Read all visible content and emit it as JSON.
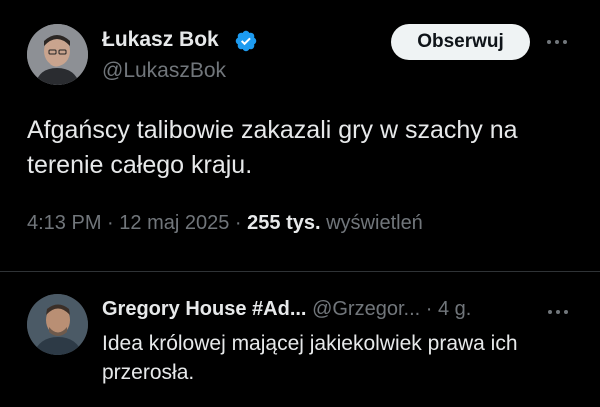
{
  "tweet": {
    "author_name": "Łukasz Bok",
    "author_handle": "@LukaszBok",
    "follow_label": "Obserwuj",
    "text": "Afgańscy talibowie zakazali gry w szachy na terenie całego kraju.",
    "time": "4:13 PM",
    "date": "12 maj 2025",
    "views_count": "255 tys.",
    "views_label": "wyświetleń",
    "separator": "·"
  },
  "reply": {
    "author_name": "Gregory House #Ad...",
    "author_handle": "@Grzegor...",
    "separator": "·",
    "time": "4 g.",
    "text": "Idea królowej mającej jakiekolwiek prawa ich przerosła."
  },
  "colors": {
    "background": "#000000",
    "primary_text": "#e7e9ea",
    "secondary_text": "#71767b",
    "verified_badge": "#1d9bf0",
    "follow_button_bg": "#eff3f4",
    "divider": "#2f3336"
  },
  "icons": {
    "verified": "verified-badge-icon",
    "more": "more-options-icon"
  }
}
